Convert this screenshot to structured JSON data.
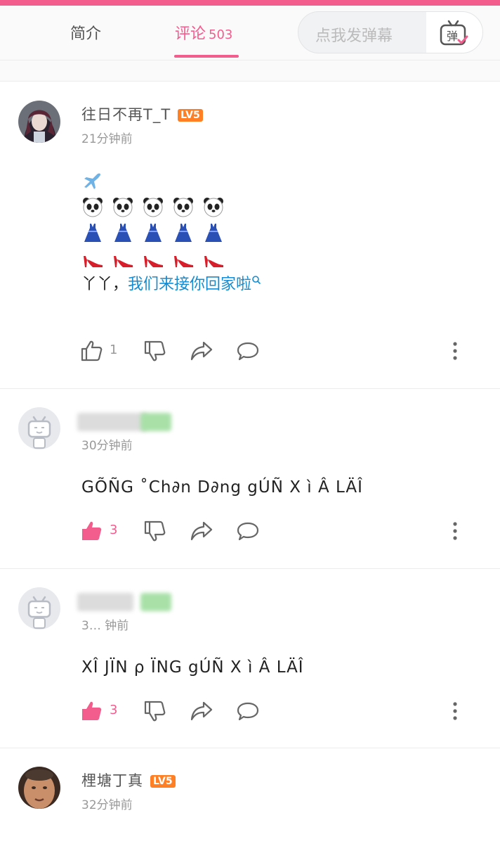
{
  "tabs": {
    "intro_label": "简介",
    "comments_label": "评论",
    "comments_count": "503"
  },
  "danmaku": {
    "placeholder": "点我发弹幕",
    "button_icon": "danmaku-tv-icon",
    "button_text": "弹"
  },
  "colors": {
    "accent": "#f25d8e",
    "link": "#178bcf",
    "level_badge": "#ff7f24"
  },
  "comments": [
    {
      "username": "往日不再T_T",
      "level": "LV5",
      "time": "21分钟前",
      "emoji_lines": [
        "airplane",
        "panda x5",
        "blue-dress x5",
        "red-high-heel x5"
      ],
      "text_prefix": "丫丫，",
      "text_link": "我们来接你回家啦",
      "likes": "1",
      "liked": false
    },
    {
      "username": "",
      "time": "30分钟前",
      "text": "GÕÑG ˚Ch∂n D∂ng gÚÑ  X ì Â   LÄÎ",
      "likes": "3",
      "liked": true
    },
    {
      "username": "",
      "time": "3… 钟前",
      "text": "XÎ  JÏN   ρ ÏNG  gÚÑ   X ì Â    LÄÎ",
      "likes": "3",
      "liked": true
    },
    {
      "username": "梩塘丁真",
      "level": "LV5",
      "time": "32分钟前"
    }
  ]
}
